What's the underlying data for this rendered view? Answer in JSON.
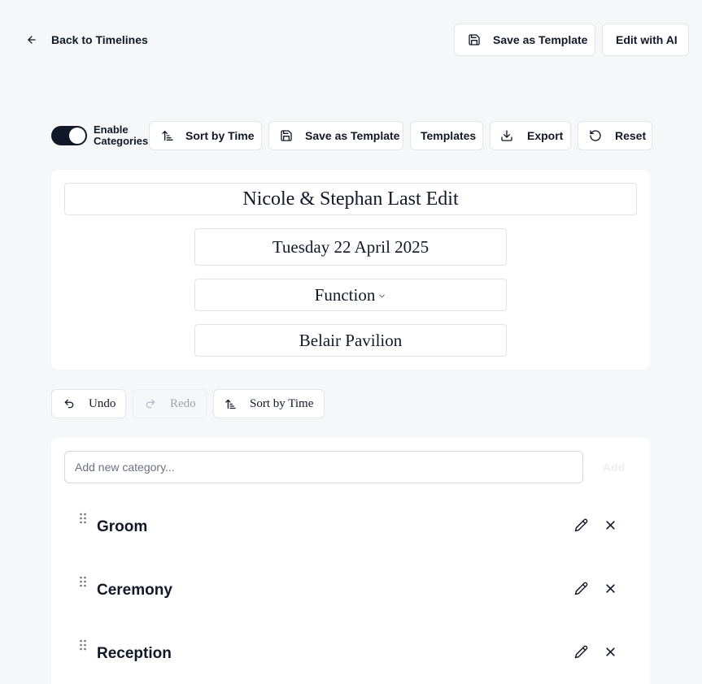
{
  "header": {
    "back_label": "Back to Timelines",
    "save_template_label": "Save as Template",
    "edit_ai_label": "Edit with AI"
  },
  "toolbar": {
    "toggle_label_line1": "Enable",
    "toggle_label_line2": "Categories",
    "toggle_on": true,
    "sort_label": "Sort by Time",
    "save_template_label": "Save as Template",
    "templates_label": "Templates",
    "export_label": "Export",
    "reset_label": "Reset"
  },
  "event": {
    "title": "Nicole & Stephan Last Edit",
    "date": "Tuesday 22 April 2025",
    "function": "Function",
    "venue": "Belair Pavilion"
  },
  "history": {
    "undo_label": "Undo",
    "redo_label": "Redo",
    "sort_label": "Sort by Time"
  },
  "categories": {
    "placeholder": "Add new category...",
    "add_label": "Add",
    "items": [
      {
        "label": "Groom"
      },
      {
        "label": "Ceremony"
      },
      {
        "label": "Reception"
      }
    ]
  },
  "colors": {
    "background": "#f6f7f9",
    "accent": "#111827",
    "border": "#e3e5e9"
  }
}
